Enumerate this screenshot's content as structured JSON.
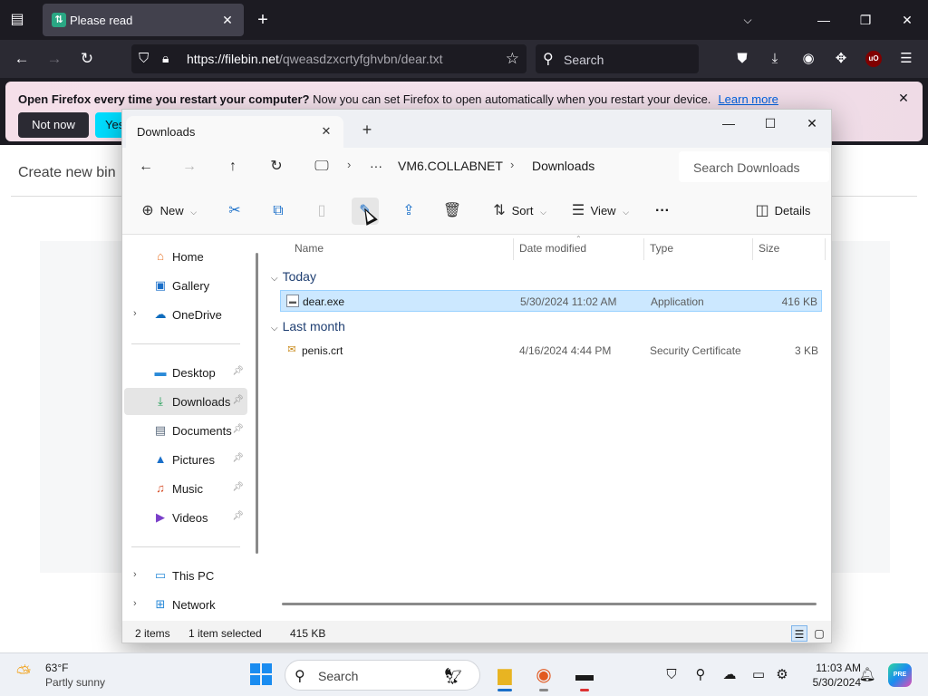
{
  "firefox": {
    "tab_title": "Please read",
    "new_tab_symbol": "+",
    "url_host": "https://filebin.net",
    "url_path": "/qweasdzxcrtyfghvbn/dear.txt",
    "search_placeholder": "Search",
    "notice": {
      "bold_text": "Open Firefox every time you restart your computer?",
      "text": " Now you can set Firefox to open automatically when you restart your device.",
      "link": "Learn more",
      "not_now": "Not now",
      "yes": "Yes,"
    },
    "ublock_label": "uO"
  },
  "page": {
    "create_text": "Create new bin"
  },
  "explorer": {
    "tab_title": "Downloads",
    "breadcrumb": [
      "VM6.COLLABNET",
      "Downloads"
    ],
    "ellipsis": "···",
    "search_placeholder": "Search Downloads",
    "commands": {
      "new": "New",
      "sort": "Sort",
      "view": "View",
      "more": "···",
      "details": "Details"
    },
    "nav": {
      "home": "Home",
      "gallery": "Gallery",
      "onedrive": "OneDrive",
      "desktop": "Desktop",
      "downloads": "Downloads",
      "documents": "Documents",
      "pictures": "Pictures",
      "music": "Music",
      "videos": "Videos",
      "thispc": "This PC",
      "network": "Network"
    },
    "columns": {
      "name": "Name",
      "date": "Date modified",
      "type": "Type",
      "size": "Size"
    },
    "groups": [
      {
        "label": "Today",
        "files": [
          {
            "name": "dear.exe",
            "date": "5/30/2024 11:02 AM",
            "type": "Application",
            "size": "416 KB"
          }
        ]
      },
      {
        "label": "Last month",
        "files": [
          {
            "name": "penis.crt",
            "date": "4/16/2024 4:44 PM",
            "type": "Security Certificate",
            "size": "3 KB"
          }
        ]
      }
    ],
    "status": {
      "items": "2 items",
      "selected": "1 item selected",
      "selected_size": "415 KB"
    }
  },
  "taskbar": {
    "temperature": "63°F",
    "condition": "Partly sunny",
    "search_placeholder": "Search",
    "time": "11:03 AM",
    "date": "5/30/2024",
    "copilot_label": "PRE"
  },
  "colors": {
    "accent": "#1a6fc9",
    "selection": "#cce8ff",
    "firefox_dark": "#1c1b22"
  }
}
